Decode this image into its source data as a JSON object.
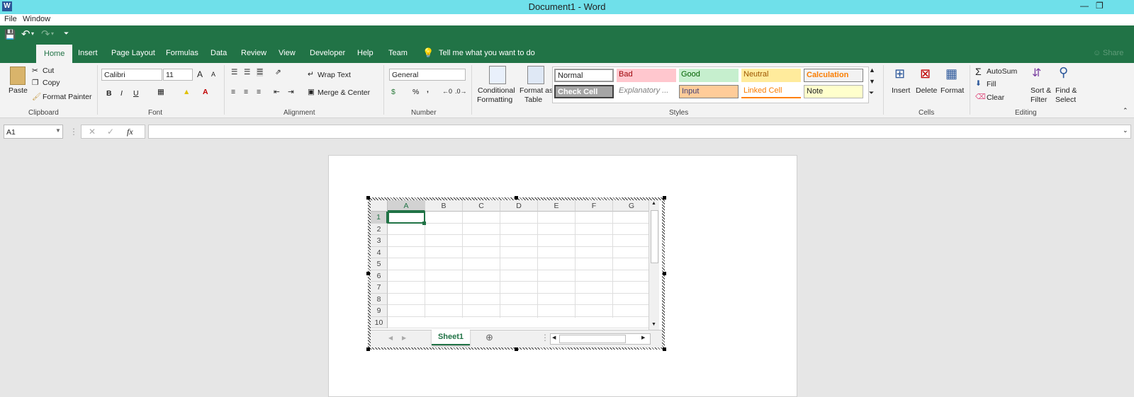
{
  "window": {
    "title": "Document1 - Word",
    "app_icon": "W"
  },
  "menubar": [
    "File",
    "Window"
  ],
  "tabs": [
    "Home",
    "Insert",
    "Page Layout",
    "Formulas",
    "Data",
    "Review",
    "View",
    "Developer",
    "Help",
    "Team"
  ],
  "tell_me": "Tell me what you want to do",
  "share": "Share",
  "clipboard": {
    "paste": "Paste",
    "cut": "Cut",
    "copy": "Copy",
    "format_painter": "Format Painter",
    "label": "Clipboard"
  },
  "font": {
    "name": "Calibri",
    "size": "11",
    "bold": "B",
    "italic": "I",
    "underline": "U",
    "grow": "A",
    "shrink": "A",
    "label": "Font"
  },
  "alignment": {
    "wrap": "Wrap Text",
    "merge": "Merge & Center",
    "label": "Alignment"
  },
  "number": {
    "format": "General",
    "percent": "%",
    "comma": ",",
    "label": "Number"
  },
  "styles": {
    "conditional": [
      "Conditional",
      "Formatting"
    ],
    "format_table": [
      "Format as",
      "Table"
    ],
    "cells": [
      "Normal",
      "Bad",
      "Good",
      "Neutral",
      "Calculation",
      "Check Cell",
      "Explanatory ...",
      "Input",
      "Linked Cell",
      "Note"
    ],
    "label": "Styles"
  },
  "cells": {
    "insert": "Insert",
    "delete": "Delete",
    "format": "Format",
    "label": "Cells"
  },
  "editing": {
    "autosum": "AutoSum",
    "fill": "Fill",
    "clear": "Clear",
    "sort": [
      "Sort &",
      "Filter"
    ],
    "find": [
      "Find &",
      "Select"
    ],
    "label": "Editing"
  },
  "formula_bar": {
    "name_box": "A1",
    "fx": "fx",
    "value": ""
  },
  "sheet": {
    "columns": [
      "A",
      "B",
      "C",
      "D",
      "E",
      "F",
      "G"
    ],
    "rows": [
      "1",
      "2",
      "3",
      "4",
      "5",
      "6",
      "7",
      "8",
      "9",
      "10"
    ],
    "tab": "Sheet1",
    "active_cell": "A1"
  },
  "colors": {
    "ribbon_green": "#217346",
    "titlebar": "#6fe0ea"
  }
}
